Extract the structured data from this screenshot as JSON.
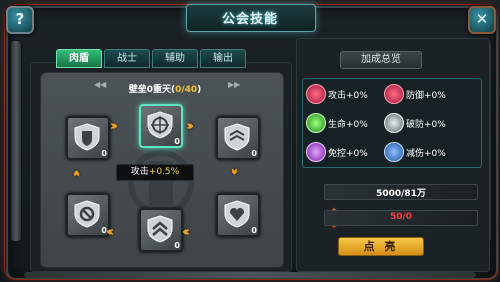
{
  "window": {
    "title": "公会技能"
  },
  "corner": {
    "help_label": "?",
    "close_label": "✕"
  },
  "tabs": [
    {
      "label": "肉盾",
      "active": true
    },
    {
      "label": "战士",
      "active": false
    },
    {
      "label": "辅助",
      "active": false
    },
    {
      "label": "输出",
      "active": false
    }
  ],
  "tier": {
    "name": "壁垒0重天(",
    "progress": "0/40",
    "close_paren": ")"
  },
  "nodes": [
    {
      "level": "0",
      "icon": "crosshair-shield-icon",
      "selected": true
    },
    {
      "level": "0",
      "icon": "shield-arrows-icon",
      "selected": false
    },
    {
      "level": "0",
      "icon": "shield-emblem-icon",
      "selected": false
    },
    {
      "level": "0",
      "icon": "heart-shield-icon",
      "selected": false
    },
    {
      "level": "0",
      "icon": "chevron-shield-icon",
      "selected": false
    },
    {
      "level": "0",
      "icon": "forbid-shield-icon",
      "selected": false
    }
  ],
  "tooltip": {
    "label": "攻击",
    "value": "+0.5%"
  },
  "summary": {
    "title": "加成总览",
    "stats": [
      {
        "label": "攻击",
        "value": "+0%",
        "icon": "target-icon",
        "color": "#e0335a"
      },
      {
        "label": "防御",
        "value": "+0%",
        "icon": "shield-icon",
        "color": "#e0335a"
      },
      {
        "label": "生命",
        "value": "+0%",
        "icon": "heart-icon",
        "color": "#4fd34f"
      },
      {
        "label": "破防",
        "value": "+0%",
        "icon": "double-chevron-icon",
        "color": "#9aa6aa"
      },
      {
        "label": "免控",
        "value": "+0%",
        "icon": "atom-icon",
        "color": "#b85be0"
      },
      {
        "label": "减伤",
        "value": "+0%",
        "icon": "shield-star-icon",
        "color": "#3f8de0"
      }
    ]
  },
  "resources": {
    "gold": {
      "value": "5000/81万",
      "color": "#ffffff"
    },
    "honor": {
      "value": "50/0",
      "color": "#ff3b3b"
    }
  },
  "action": {
    "label": "点 亮"
  }
}
